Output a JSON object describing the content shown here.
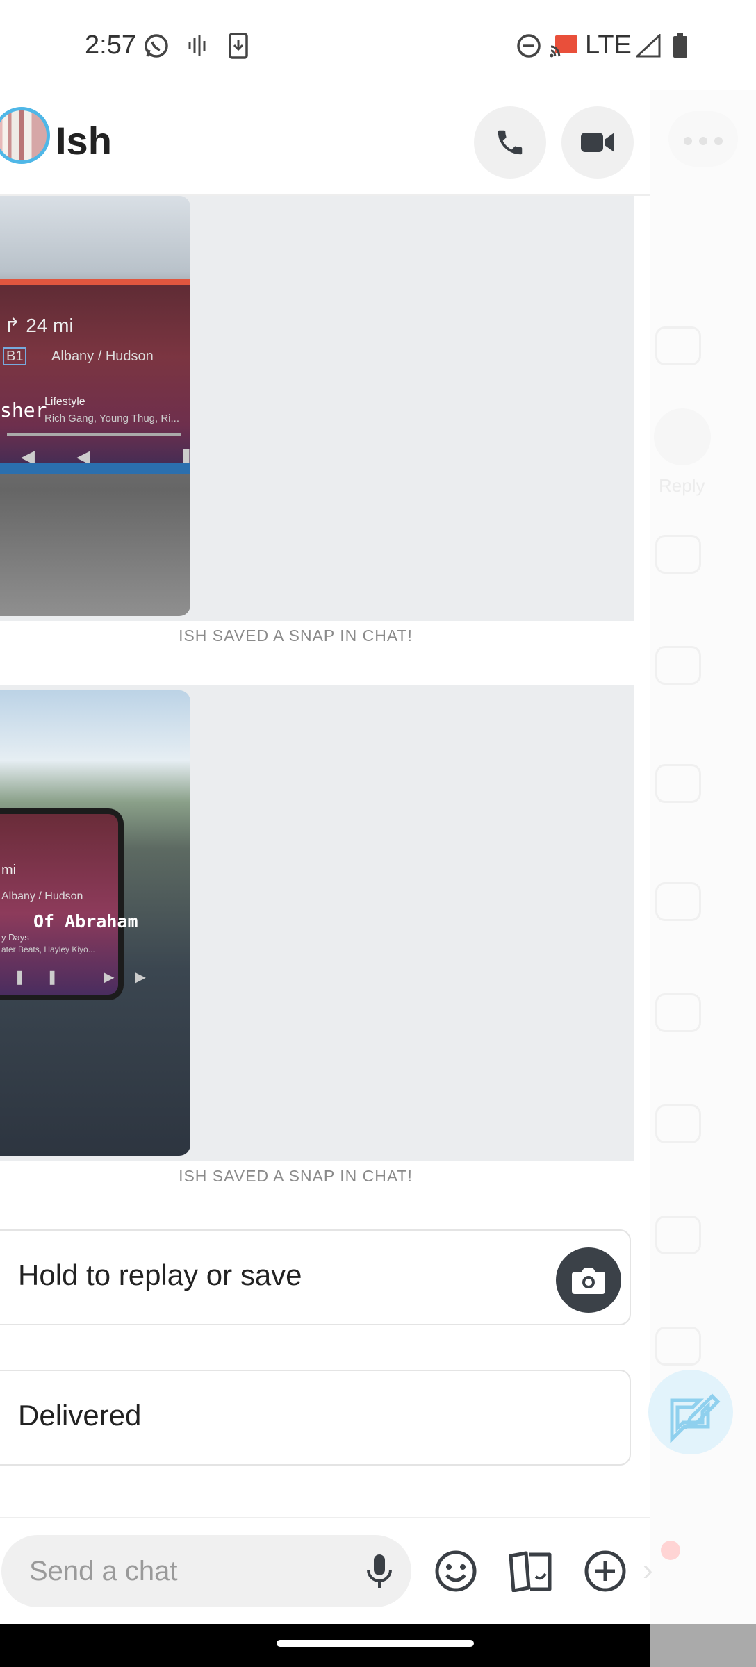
{
  "status_bar": {
    "time": "2:57",
    "network": "LTE",
    "icons": [
      "whatsapp-icon",
      "voicemail-icon",
      "download-icon",
      "dnd-icon",
      "cast-icon",
      "signal-icon",
      "battery-icon"
    ]
  },
  "header": {
    "contact_name": "Ish",
    "call_icon": "phone-icon",
    "video_icon": "video-icon"
  },
  "snaps": [
    {
      "overlay_text": "sher",
      "screen": {
        "distance": "24 mi",
        "exit": "B1",
        "route": "Albany / Hudson",
        "song_title": "Lifestyle",
        "song_artist": "Rich Gang, Young Thug, Ri..."
      },
      "note": "ISH SAVED A SNAP IN CHAT!"
    },
    {
      "overlay_text": "Of Abraham",
      "screen": {
        "distance": "mi",
        "route": "Albany / Hudson",
        "song_title": "y Days",
        "song_artist": "ater Beats, Hayley Kiyo..."
      },
      "note": "ISH SAVED A SNAP IN CHAT!"
    }
  ],
  "messages": [
    {
      "text": "Hold to replay or save",
      "action_icon": "camera-icon"
    },
    {
      "text": "Delivered"
    }
  ],
  "side_panel": {
    "reply_label": "Reply"
  },
  "input_bar": {
    "placeholder": "Send a chat",
    "icons": [
      "microphone-icon",
      "emoji-icon",
      "stickers-icon",
      "plus-icon"
    ]
  },
  "colors": {
    "accent_blue": "#4fb7e7",
    "snap_bg": "#ebedef",
    "dark_button": "#3b4148"
  }
}
